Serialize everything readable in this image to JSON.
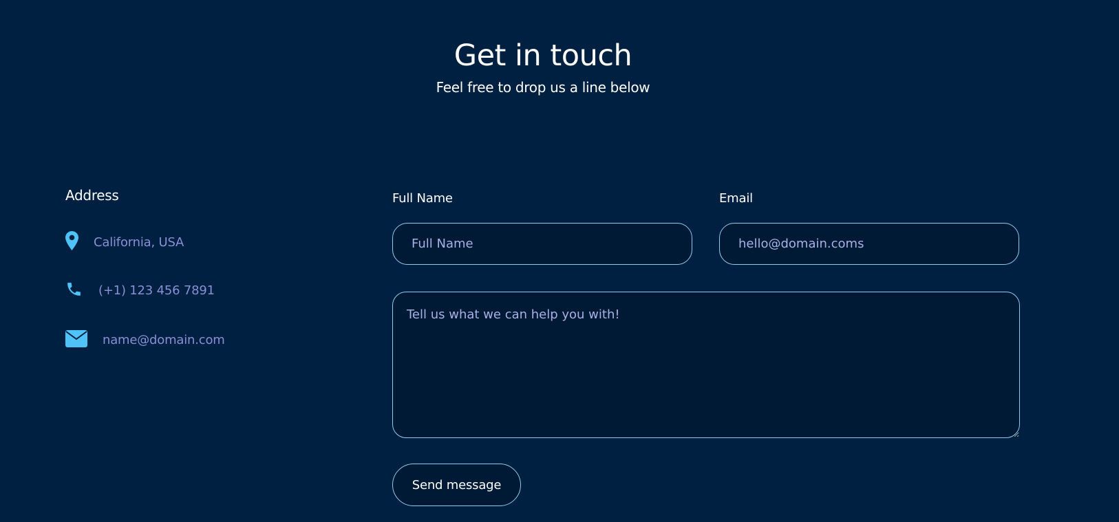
{
  "header": {
    "title": "Get in touch",
    "subtitle": "Feel free to drop us a line below"
  },
  "address": {
    "heading": "Address",
    "location": "California, USA",
    "phone": "(+1) 123 456 7891",
    "email": "name@domain.com",
    "icons": [
      "map-pin-icon",
      "phone-icon",
      "envelope-icon"
    ]
  },
  "form": {
    "full_name_label": "Full Name",
    "full_name_placeholder": "Full Name",
    "email_label": "Email",
    "email_placeholder": "hello@domain.coms",
    "message_placeholder": "Tell us what we can help you with!",
    "send_label": "Send message"
  },
  "colors": {
    "background": "#002041",
    "accent_icon": "#4fc3f7",
    "address_text": "#8a8fd6",
    "border": "#8ecdf0"
  }
}
